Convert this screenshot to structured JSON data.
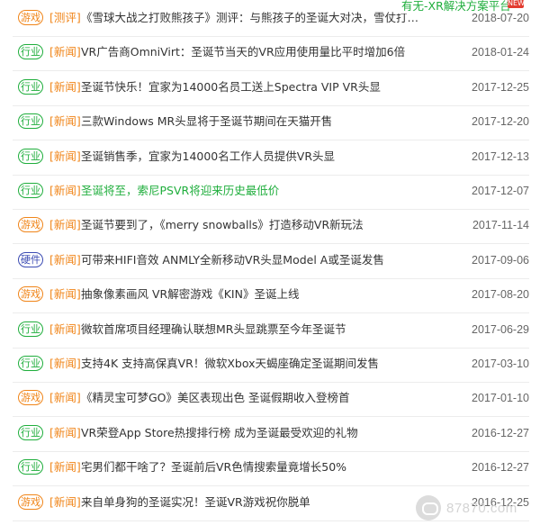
{
  "banner": {
    "text": "有无-XR解决方案平台",
    "new_label": "NEW"
  },
  "category_colors": {
    "游戏": "#f08519",
    "行业": "#1fae3c",
    "硬件": "#3b4bb3"
  },
  "items": [
    {
      "category": "游戏",
      "tag": "[测评]",
      "title": "《雪球大战之打败熊孩子》测评：与熊孩子的圣诞大对决，雪仗打出的童年...",
      "date": "2018-07-20"
    },
    {
      "category": "行业",
      "tag": "[新闻]",
      "title": "VR广告商OmniVirt：圣诞节当天的VR应用使用量比平时增加6倍",
      "date": "2018-01-24"
    },
    {
      "category": "行业",
      "tag": "[新闻]",
      "title": "圣诞节快乐！宜家为14000名员工送上Spectra VIP VR头显",
      "date": "2017-12-25"
    },
    {
      "category": "行业",
      "tag": "[新闻]",
      "title": "三款Windows MR头显将于圣诞节期间在天猫开售",
      "date": "2017-12-20"
    },
    {
      "category": "行业",
      "tag": "[新闻]",
      "title": "圣诞销售季，宜家为14000名工作人员提供VR头显",
      "date": "2017-12-13"
    },
    {
      "category": "行业",
      "tag": "[新闻]",
      "title": "圣诞将至，索尼PSVR将迎来历史最低价",
      "date": "2017-12-07",
      "highlight": true
    },
    {
      "category": "游戏",
      "tag": "[新闻]",
      "title": "圣诞节要到了，《merry snowballs》打造移动VR新玩法",
      "date": "2017-11-14"
    },
    {
      "category": "硬件",
      "tag": "[新闻]",
      "title": "可带来HIFI音效 ANMLY全新移动VR头显Model A或圣诞发售",
      "date": "2017-09-06"
    },
    {
      "category": "游戏",
      "tag": "[新闻]",
      "title": "抽象像素画风 VR解密游戏《KIN》圣诞上线",
      "date": "2017-08-20"
    },
    {
      "category": "行业",
      "tag": "[新闻]",
      "title": "微软首席项目经理确认联想MR头显跳票至今年圣诞节",
      "date": "2017-06-29"
    },
    {
      "category": "行业",
      "tag": "[新闻]",
      "title": "支持4K 支持高保真VR！微软Xbox天蝎座确定圣诞期间发售",
      "date": "2017-03-10"
    },
    {
      "category": "游戏",
      "tag": "[新闻]",
      "title": "《精灵宝可梦GO》美区表现出色 圣诞假期收入登榜首",
      "date": "2017-01-10"
    },
    {
      "category": "行业",
      "tag": "[新闻]",
      "title": "VR荣登App Store热搜排行榜 成为圣诞最受欢迎的礼物",
      "date": "2016-12-27"
    },
    {
      "category": "行业",
      "tag": "[新闻]",
      "title": "宅男们都干啥了？圣诞前后VR色情搜索量竟增长50%",
      "date": "2016-12-27"
    },
    {
      "category": "游戏",
      "tag": "[新闻]",
      "title": "来自单身狗的圣诞实况！圣诞VR游戏祝你脱单",
      "date": "2016-12-25"
    }
  ],
  "watermark": {
    "text": "87870.com",
    "icon": "vr-headset-logo-icon"
  }
}
